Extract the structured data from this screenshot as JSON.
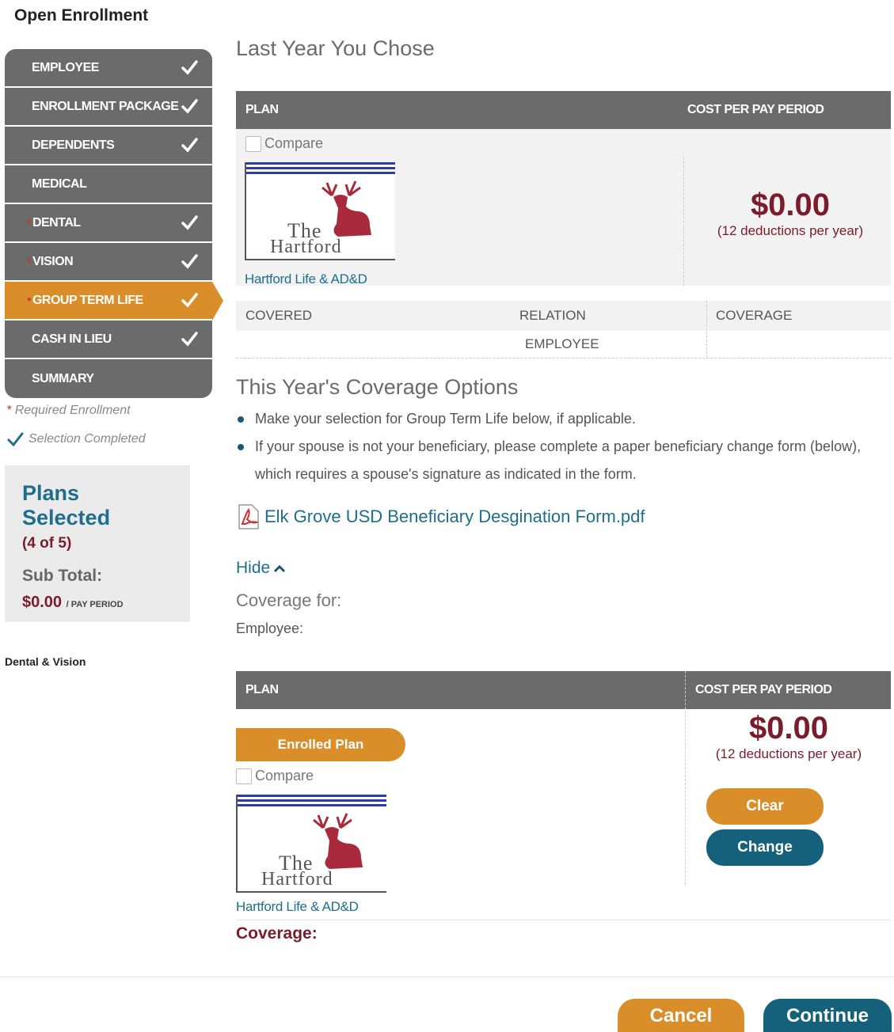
{
  "page": {
    "title": "Open Enrollment"
  },
  "sidebar": {
    "items": [
      {
        "label": "EMPLOYEE",
        "required": false,
        "completed": true,
        "active": false
      },
      {
        "label": "ENROLLMENT PACKAGE",
        "required": false,
        "completed": true,
        "active": false
      },
      {
        "label": "DEPENDENTS",
        "required": false,
        "completed": true,
        "active": false
      },
      {
        "label": "MEDICAL",
        "required": false,
        "completed": false,
        "active": false
      },
      {
        "label": "DENTAL",
        "required": true,
        "completed": true,
        "active": false
      },
      {
        "label": "VISION",
        "required": true,
        "completed": true,
        "active": false
      },
      {
        "label": "GROUP TERM LIFE",
        "required": true,
        "completed": true,
        "active": true
      },
      {
        "label": "CASH IN LIEU",
        "required": false,
        "completed": true,
        "active": false
      },
      {
        "label": "SUMMARY",
        "required": false,
        "completed": false,
        "active": false
      }
    ],
    "required_marker": "*",
    "legend_required": "Required Enrollment",
    "legend_completed": "Selection Completed",
    "plans_selected": {
      "title": "Plans Selected",
      "count": "(4 of 5)",
      "subtotal_label": "Sub Total:",
      "subtotal_value": "$0.00",
      "subtotal_unit": "/ PAY PERIOD"
    },
    "note": "Dental & Vision"
  },
  "last_year": {
    "heading": "Last Year You Chose",
    "col_plan": "PLAN",
    "col_cost": "COST PER PAY PERIOD",
    "compare_label": "Compare",
    "logo_word1": "The",
    "logo_word2": "Hartford",
    "carrier": "Hartford Life & AD&D",
    "price": "$0.00",
    "price_note": "(12 deductions per year)",
    "col_covered": "COVERED",
    "col_relation": "RELATION",
    "col_coverage": "COVERAGE",
    "relation_value": "EMPLOYEE"
  },
  "this_year": {
    "heading": "This Year's Coverage Options",
    "bullets": [
      "Make your selection for Group Term Life below, if applicable.",
      "If your spouse is not your beneficiary, please complete a paper beneficiary change form (below), which requires a spouse's signature as indicated in the form."
    ],
    "pdf_link": "Elk Grove USD Beneficiary Desgination Form.pdf",
    "hide_label": "Hide",
    "coverage_for": "Coverage for:",
    "employee_label": "Employee:",
    "col_plan": "PLAN",
    "col_cost": "COST PER PAY PERIOD",
    "enrolled_badge": "Enrolled Plan",
    "compare_label": "Compare",
    "logo_word1": "The",
    "logo_word2": "Hartford",
    "carrier": "Hartford Life & AD&D",
    "price": "$0.00",
    "price_note": "(12 deductions per year)",
    "clear_label": "Clear",
    "change_label": "Change",
    "coverage_label": "Coverage:"
  },
  "footer": {
    "cancel_label": "Cancel",
    "continue_label": "Continue"
  },
  "colors": {
    "nav_gray": "#6b6b6b",
    "accent_orange": "#d98e2a",
    "teal": "#15607a",
    "maroon": "#7a1c2c",
    "link_blue": "#1e6e8c"
  }
}
